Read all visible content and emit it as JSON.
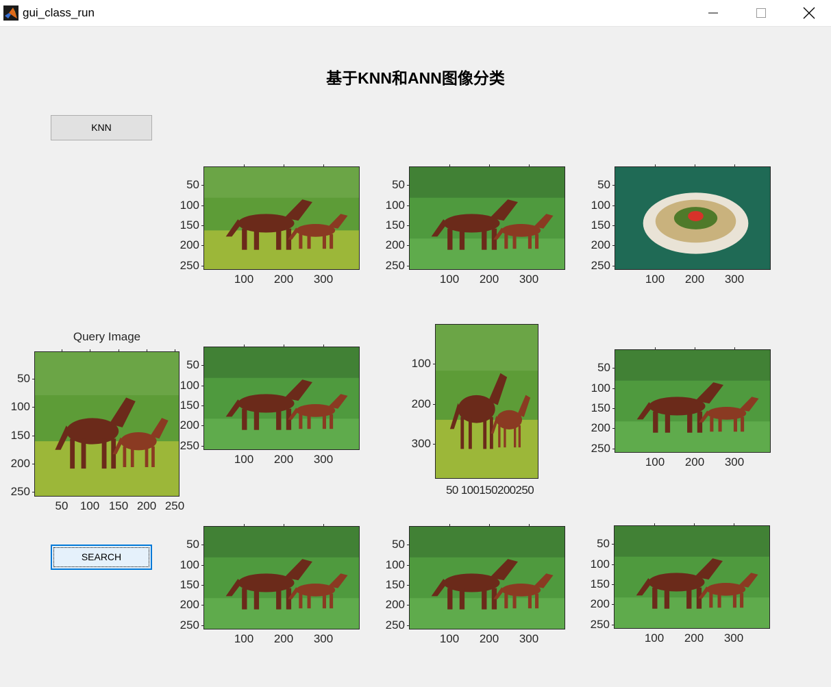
{
  "window": {
    "title": "gui_class_run"
  },
  "heading": "基于KNN和ANN图像分类",
  "buttons": {
    "knn": "KNN",
    "search": "SEARCH"
  },
  "query": {
    "title": "Query Image"
  },
  "ticks": {
    "t50": "50",
    "t100": "100",
    "t150": "150",
    "t200": "200",
    "t250": "250",
    "t300": "300",
    "mid_x": "50 100150200250"
  },
  "icons": [
    "matlab-icon",
    "minimize-icon",
    "maximize-icon",
    "close-icon"
  ],
  "colors": {
    "background": "#f0f0f0",
    "titlebar": "#ffffff",
    "search_focus": "#0078d7"
  }
}
